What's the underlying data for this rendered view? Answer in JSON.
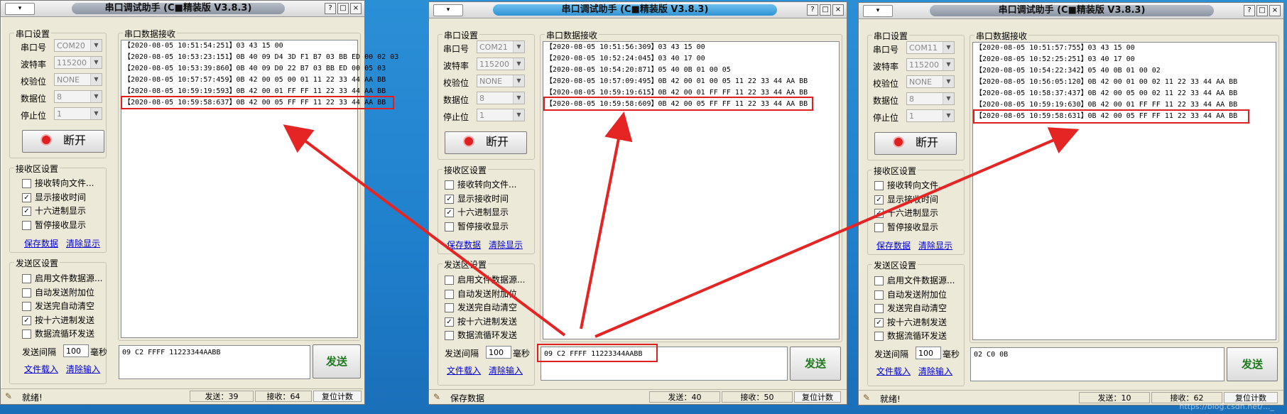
{
  "app_title": "串口调试助手 (C■精装版 V3.8.3)",
  "sysmenu_label": "▾",
  "window_buttons": [
    "?",
    "□",
    "×"
  ],
  "labels": {
    "serial_group": "串口设置",
    "port": "串口号",
    "baud": "波特率",
    "parity": "校验位",
    "databits": "数据位",
    "stopbits": "停止位",
    "disconnect": "断开",
    "recv_group": "串口数据接收",
    "recv_settings": "接收区设置",
    "send_settings": "发送区设置",
    "recv_to_file": "接收转向文件...",
    "show_time": "显示接收时间",
    "hex_display": "十六进制显示",
    "pause_display": "暂停接收显示",
    "save_data": "保存数据",
    "clear_display": "清除显示",
    "enable_file_source": "启用文件数据源...",
    "auto_append": "自动发送附加位",
    "auto_clear": "发送完自动清空",
    "hex_send": "按十六进制发送",
    "loop_send": "数据流循环发送",
    "send_interval": "发送间隔",
    "ms": "毫秒",
    "load_file": "文件载入",
    "clear_input": "清除输入",
    "send": "发送",
    "reset_count": "复位计数"
  },
  "checkbox_states": {
    "recv_to_file": false,
    "show_time": true,
    "hex_display": true,
    "pause_display": false,
    "enable_file_source": false,
    "auto_append": false,
    "auto_clear": false,
    "hex_send": true,
    "loop_send": false
  },
  "windows": [
    {
      "port": "COM20",
      "baud": "115200",
      "parity": "NONE",
      "databits": "8",
      "stopbits": "1",
      "received": [
        "【2020-08-05 10:51:54:251】03 43 15 00",
        "【2020-08-05 10:53:23:151】0B 40 09 D4 3D F1 B7 03 BB ED 00 02 03",
        "【2020-08-05 10:53:39:860】0B 40 09 D0 22 B7 03 BB ED 00 05 03",
        "【2020-08-05 10:57:57:459】0B 42 00 05 00 01 11 22 33 44 AA BB",
        "【2020-08-05 10:59:19:593】0B 42 00 01 FF FF 11 22 33 44 AA BB",
        "【2020-08-05 10:59:58:637】0B 42 00 05 FF FF 11 22 33 44 AA BB"
      ],
      "send_text": "09 C2 FFFF 11223344AABB",
      "interval": "100",
      "status": "就绪!",
      "sent": "发送：39",
      "recv": "接收：64"
    },
    {
      "port": "COM21",
      "baud": "115200",
      "parity": "NONE",
      "databits": "8",
      "stopbits": "1",
      "received": [
        "【2020-08-05 10:51:56:309】03 43 15 00",
        "【2020-08-05 10:52:24:045】03 40 17 00",
        "【2020-08-05 10:54:20:871】05 40 0B 01 00 05",
        "【2020-08-05 10:57:09:495】0B 42 00 01 00 05 11 22 33 44 AA BB",
        "【2020-08-05 10:59:19:615】0B 42 00 01 FF FF 11 22 33 44 AA BB",
        "【2020-08-05 10:59:58:609】0B 42 00 05 FF FF 11 22 33 44 AA BB"
      ],
      "send_text": "09 C2 FFFF 11223344AABB",
      "interval": "100",
      "status": "保存数据",
      "sent": "发送：40",
      "recv": "接收：50"
    },
    {
      "port": "COM11",
      "baud": "115200",
      "parity": "NONE",
      "databits": "8",
      "stopbits": "1",
      "received": [
        "【2020-08-05 10:51:57:755】03 43 15 00",
        "【2020-08-05 10:52:25:251】03 40 17 00",
        "【2020-08-05 10:54:22:342】05 40 0B 01 00 02",
        "【2020-08-05 10:56:05:120】0B 42 00 01 00 02 11 22 33 44 AA BB",
        "【2020-08-05 10:58:37:437】0B 42 00 05 00 02 11 22 33 44 AA BB",
        "【2020-08-05 10:59:19:630】0B 42 00 01 FF FF 11 22 33 44 AA BB",
        "【2020-08-05 10:59:58:631】0B 42 00 05 FF FF 11 22 33 44 AA BB"
      ],
      "send_text": "02 C0 0B",
      "interval": "100",
      "status": "就绪!",
      "sent": "发送：10",
      "recv": "接收：62"
    }
  ],
  "watermark": "https://blog.csdn.net/..._"
}
